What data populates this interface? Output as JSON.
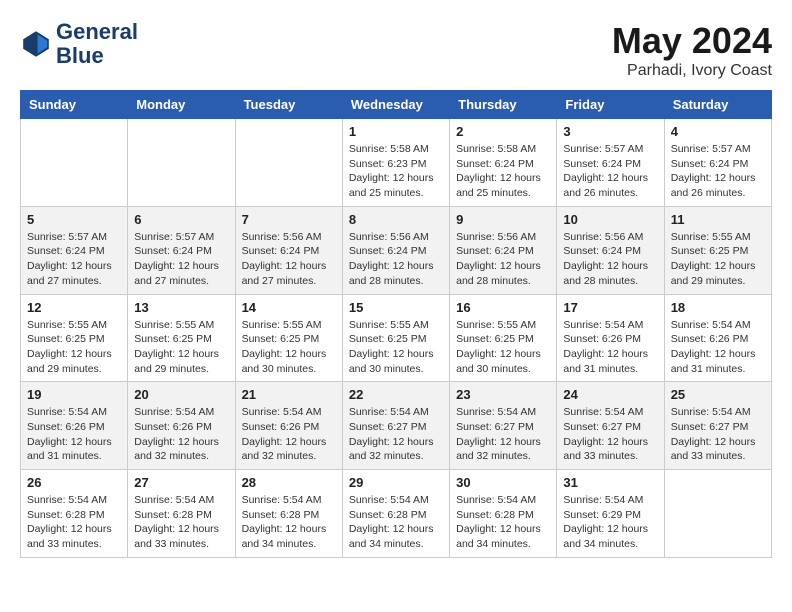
{
  "header": {
    "logo_line1": "General",
    "logo_line2": "Blue",
    "month": "May 2024",
    "location": "Parhadi, Ivory Coast"
  },
  "weekdays": [
    "Sunday",
    "Monday",
    "Tuesday",
    "Wednesday",
    "Thursday",
    "Friday",
    "Saturday"
  ],
  "weeks": [
    [
      {
        "day": "",
        "info": ""
      },
      {
        "day": "",
        "info": ""
      },
      {
        "day": "",
        "info": ""
      },
      {
        "day": "1",
        "info": "Sunrise: 5:58 AM\nSunset: 6:23 PM\nDaylight: 12 hours\nand 25 minutes."
      },
      {
        "day": "2",
        "info": "Sunrise: 5:58 AM\nSunset: 6:24 PM\nDaylight: 12 hours\nand 25 minutes."
      },
      {
        "day": "3",
        "info": "Sunrise: 5:57 AM\nSunset: 6:24 PM\nDaylight: 12 hours\nand 26 minutes."
      },
      {
        "day": "4",
        "info": "Sunrise: 5:57 AM\nSunset: 6:24 PM\nDaylight: 12 hours\nand 26 minutes."
      }
    ],
    [
      {
        "day": "5",
        "info": "Sunrise: 5:57 AM\nSunset: 6:24 PM\nDaylight: 12 hours\nand 27 minutes."
      },
      {
        "day": "6",
        "info": "Sunrise: 5:57 AM\nSunset: 6:24 PM\nDaylight: 12 hours\nand 27 minutes."
      },
      {
        "day": "7",
        "info": "Sunrise: 5:56 AM\nSunset: 6:24 PM\nDaylight: 12 hours\nand 27 minutes."
      },
      {
        "day": "8",
        "info": "Sunrise: 5:56 AM\nSunset: 6:24 PM\nDaylight: 12 hours\nand 28 minutes."
      },
      {
        "day": "9",
        "info": "Sunrise: 5:56 AM\nSunset: 6:24 PM\nDaylight: 12 hours\nand 28 minutes."
      },
      {
        "day": "10",
        "info": "Sunrise: 5:56 AM\nSunset: 6:24 PM\nDaylight: 12 hours\nand 28 minutes."
      },
      {
        "day": "11",
        "info": "Sunrise: 5:55 AM\nSunset: 6:25 PM\nDaylight: 12 hours\nand 29 minutes."
      }
    ],
    [
      {
        "day": "12",
        "info": "Sunrise: 5:55 AM\nSunset: 6:25 PM\nDaylight: 12 hours\nand 29 minutes."
      },
      {
        "day": "13",
        "info": "Sunrise: 5:55 AM\nSunset: 6:25 PM\nDaylight: 12 hours\nand 29 minutes."
      },
      {
        "day": "14",
        "info": "Sunrise: 5:55 AM\nSunset: 6:25 PM\nDaylight: 12 hours\nand 30 minutes."
      },
      {
        "day": "15",
        "info": "Sunrise: 5:55 AM\nSunset: 6:25 PM\nDaylight: 12 hours\nand 30 minutes."
      },
      {
        "day": "16",
        "info": "Sunrise: 5:55 AM\nSunset: 6:25 PM\nDaylight: 12 hours\nand 30 minutes."
      },
      {
        "day": "17",
        "info": "Sunrise: 5:54 AM\nSunset: 6:26 PM\nDaylight: 12 hours\nand 31 minutes."
      },
      {
        "day": "18",
        "info": "Sunrise: 5:54 AM\nSunset: 6:26 PM\nDaylight: 12 hours\nand 31 minutes."
      }
    ],
    [
      {
        "day": "19",
        "info": "Sunrise: 5:54 AM\nSunset: 6:26 PM\nDaylight: 12 hours\nand 31 minutes."
      },
      {
        "day": "20",
        "info": "Sunrise: 5:54 AM\nSunset: 6:26 PM\nDaylight: 12 hours\nand 32 minutes."
      },
      {
        "day": "21",
        "info": "Sunrise: 5:54 AM\nSunset: 6:26 PM\nDaylight: 12 hours\nand 32 minutes."
      },
      {
        "day": "22",
        "info": "Sunrise: 5:54 AM\nSunset: 6:27 PM\nDaylight: 12 hours\nand 32 minutes."
      },
      {
        "day": "23",
        "info": "Sunrise: 5:54 AM\nSunset: 6:27 PM\nDaylight: 12 hours\nand 32 minutes."
      },
      {
        "day": "24",
        "info": "Sunrise: 5:54 AM\nSunset: 6:27 PM\nDaylight: 12 hours\nand 33 minutes."
      },
      {
        "day": "25",
        "info": "Sunrise: 5:54 AM\nSunset: 6:27 PM\nDaylight: 12 hours\nand 33 minutes."
      }
    ],
    [
      {
        "day": "26",
        "info": "Sunrise: 5:54 AM\nSunset: 6:28 PM\nDaylight: 12 hours\nand 33 minutes."
      },
      {
        "day": "27",
        "info": "Sunrise: 5:54 AM\nSunset: 6:28 PM\nDaylight: 12 hours\nand 33 minutes."
      },
      {
        "day": "28",
        "info": "Sunrise: 5:54 AM\nSunset: 6:28 PM\nDaylight: 12 hours\nand 34 minutes."
      },
      {
        "day": "29",
        "info": "Sunrise: 5:54 AM\nSunset: 6:28 PM\nDaylight: 12 hours\nand 34 minutes."
      },
      {
        "day": "30",
        "info": "Sunrise: 5:54 AM\nSunset: 6:28 PM\nDaylight: 12 hours\nand 34 minutes."
      },
      {
        "day": "31",
        "info": "Sunrise: 5:54 AM\nSunset: 6:29 PM\nDaylight: 12 hours\nand 34 minutes."
      },
      {
        "day": "",
        "info": ""
      }
    ]
  ]
}
